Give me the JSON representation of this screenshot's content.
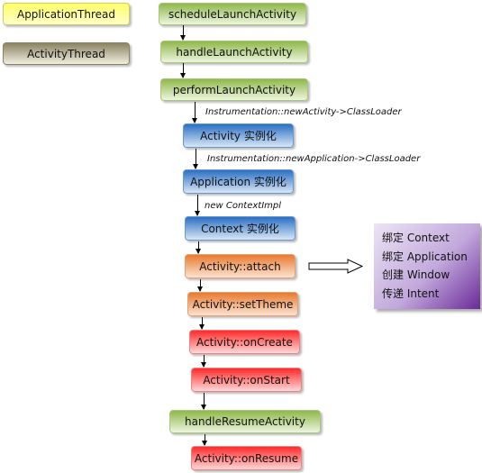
{
  "legend": [
    {
      "label": "ApplicationThread"
    },
    {
      "label": "ActivityThread"
    }
  ],
  "steps": [
    "scheduleLaunchActivity",
    "handleLaunchActivity",
    "performLaunchActivity",
    "Activity 实例化",
    "Application 实例化",
    "Context 实例化",
    "Activity::attach",
    "Activity::setTheme",
    "Activity::onCreate",
    "Activity::onStart",
    "handleResumeActivity",
    "Activity::onResume"
  ],
  "edge_labels": [
    "Instrumentation::newActivity->ClassLoader",
    "Instrumentation::newApplication->ClassLoader",
    "new ContextImpl"
  ],
  "attach_note": [
    "绑定 Context",
    "绑定 Application",
    "创建 Window",
    "传递 Intent"
  ]
}
